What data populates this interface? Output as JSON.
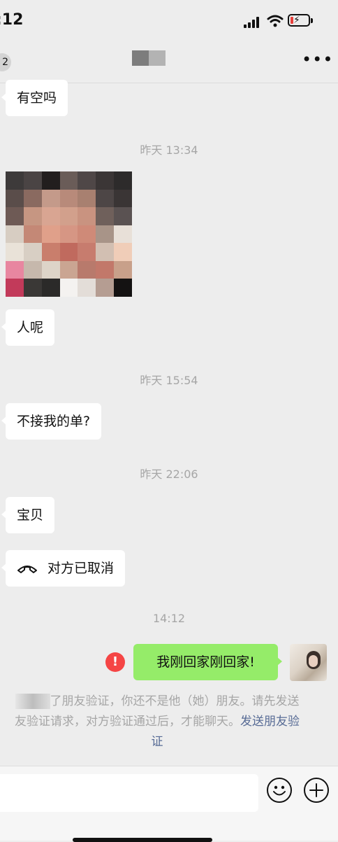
{
  "status_bar": {
    "time": ":12"
  },
  "nav": {
    "back_count": "2",
    "more_label": "•••"
  },
  "messages": {
    "m1": "有空吗",
    "ts1": "昨天 13:34",
    "m2": "人呢",
    "ts2": "昨天 15:54",
    "m3": "不接我的单?",
    "ts3": "昨天 22:06",
    "m4": "宝贝",
    "call": "对方已取消",
    "ts4": "14:12",
    "sent": "我刚回家刚回家!"
  },
  "system_notice": {
    "text_1": "了朋友验证，你还不是他（她）朋友。请先发送",
    "text_2": "友验证请求，对方验证通过后，才能聊天。",
    "link": "发送朋友验",
    "text_3": "证"
  },
  "input": {
    "placeholder": ""
  },
  "colors": {
    "background": "#ededed",
    "sent_bubble": "#95ec69",
    "error": "#f54545",
    "link": "#576b95",
    "timestamp": "#a6a6a6"
  },
  "photo_colors": [
    "#3d3a3a",
    "#4a4444",
    "#221e1e",
    "#6a5c58",
    "#4f4747",
    "#3b3636",
    "#2d2b2b",
    "#5a4d4a",
    "#8a6a60",
    "#c49a8a",
    "#b88a7a",
    "#a88070",
    "#4d4646",
    "#3a3535",
    "#6e5a55",
    "#c69682",
    "#d9a592",
    "#d2a08c",
    "#c99380",
    "#6f605b",
    "#5a5252",
    "#d7cdc2",
    "#c48876",
    "#e0a08a",
    "#d69684",
    "#cf8a78",
    "#a89488",
    "#e8e0d8",
    "#e9e2d8",
    "#d8cfc4",
    "#c97e6c",
    "#c06a5e",
    "#c77c6e",
    "#d2bfb2",
    "#f0cdb8",
    "#e886a0",
    "#c6b8ac",
    "#ddd4c8",
    "#caa592",
    "#b87a6c",
    "#c2786a",
    "#c8a08a",
    "#c23a5a",
    "#3a3836",
    "#2b2a29",
    "#f4f2f0",
    "#e3ddd8",
    "#b59d92",
    "#141212"
  ]
}
